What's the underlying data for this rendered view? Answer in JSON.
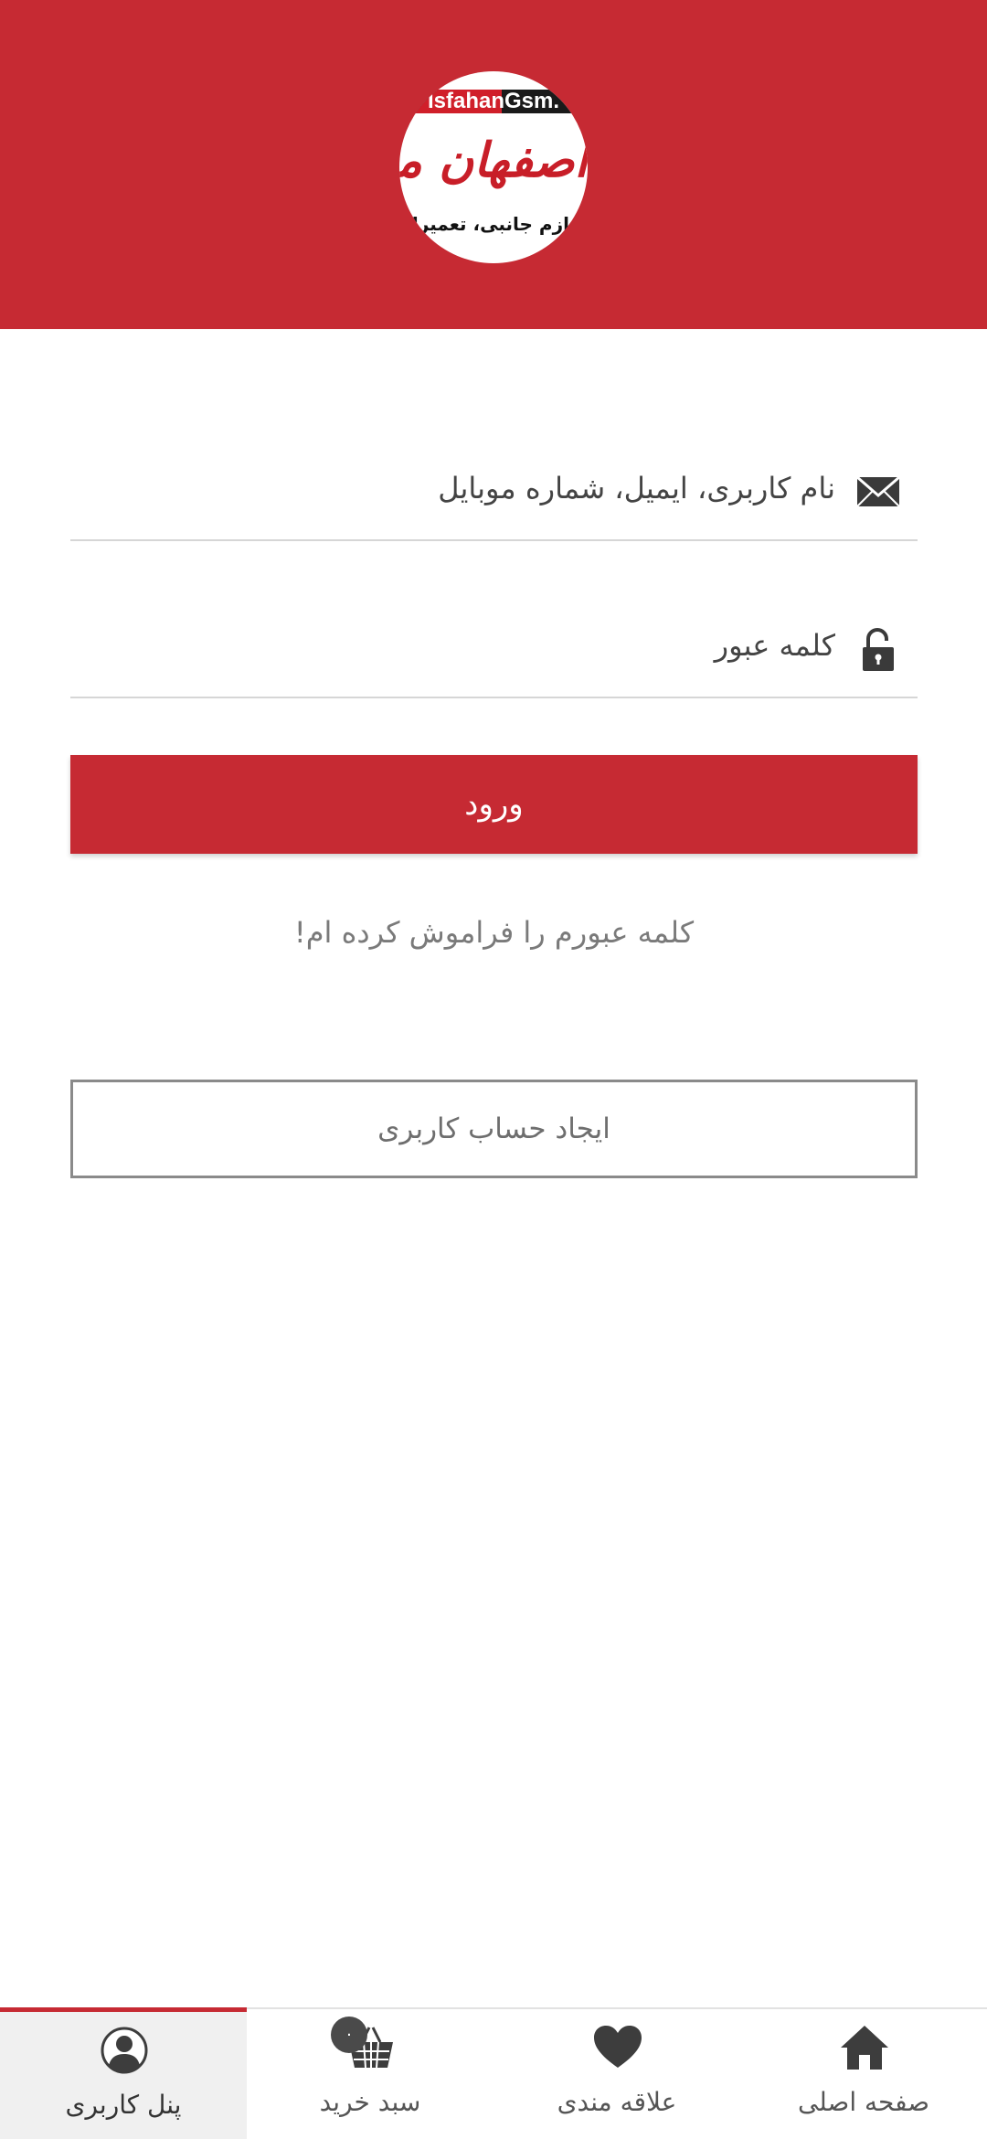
{
  "header": {
    "logo": {
      "top_text": "IsfahanGsm.",
      "script_text": "اصفهان موبایل",
      "bottom_text": "لوازم جانبی، تعمیرات"
    },
    "brand_color": "#c62a33"
  },
  "login_form": {
    "username_placeholder": "نام کاربری، ایمیل، شماره موبایل",
    "username_icon": "envelope-icon",
    "password_placeholder": "کلمه عبور",
    "password_icon": "unlocked-padlock-icon",
    "login_button": "ورود",
    "forgot_password": "کلمه عبورم را فراموش کرده ام!",
    "register_button": "ایجاد حساب کاربری"
  },
  "bottom_nav": {
    "items": [
      {
        "label": "صفحه اصلی",
        "icon": "home-icon"
      },
      {
        "label": "علاقه مندی",
        "icon": "heart-icon"
      },
      {
        "label": "سبد خرید",
        "icon": "basket-icon",
        "badge": "۰"
      },
      {
        "label": "پنل کاربری",
        "icon": "user-icon",
        "active": true
      }
    ]
  }
}
